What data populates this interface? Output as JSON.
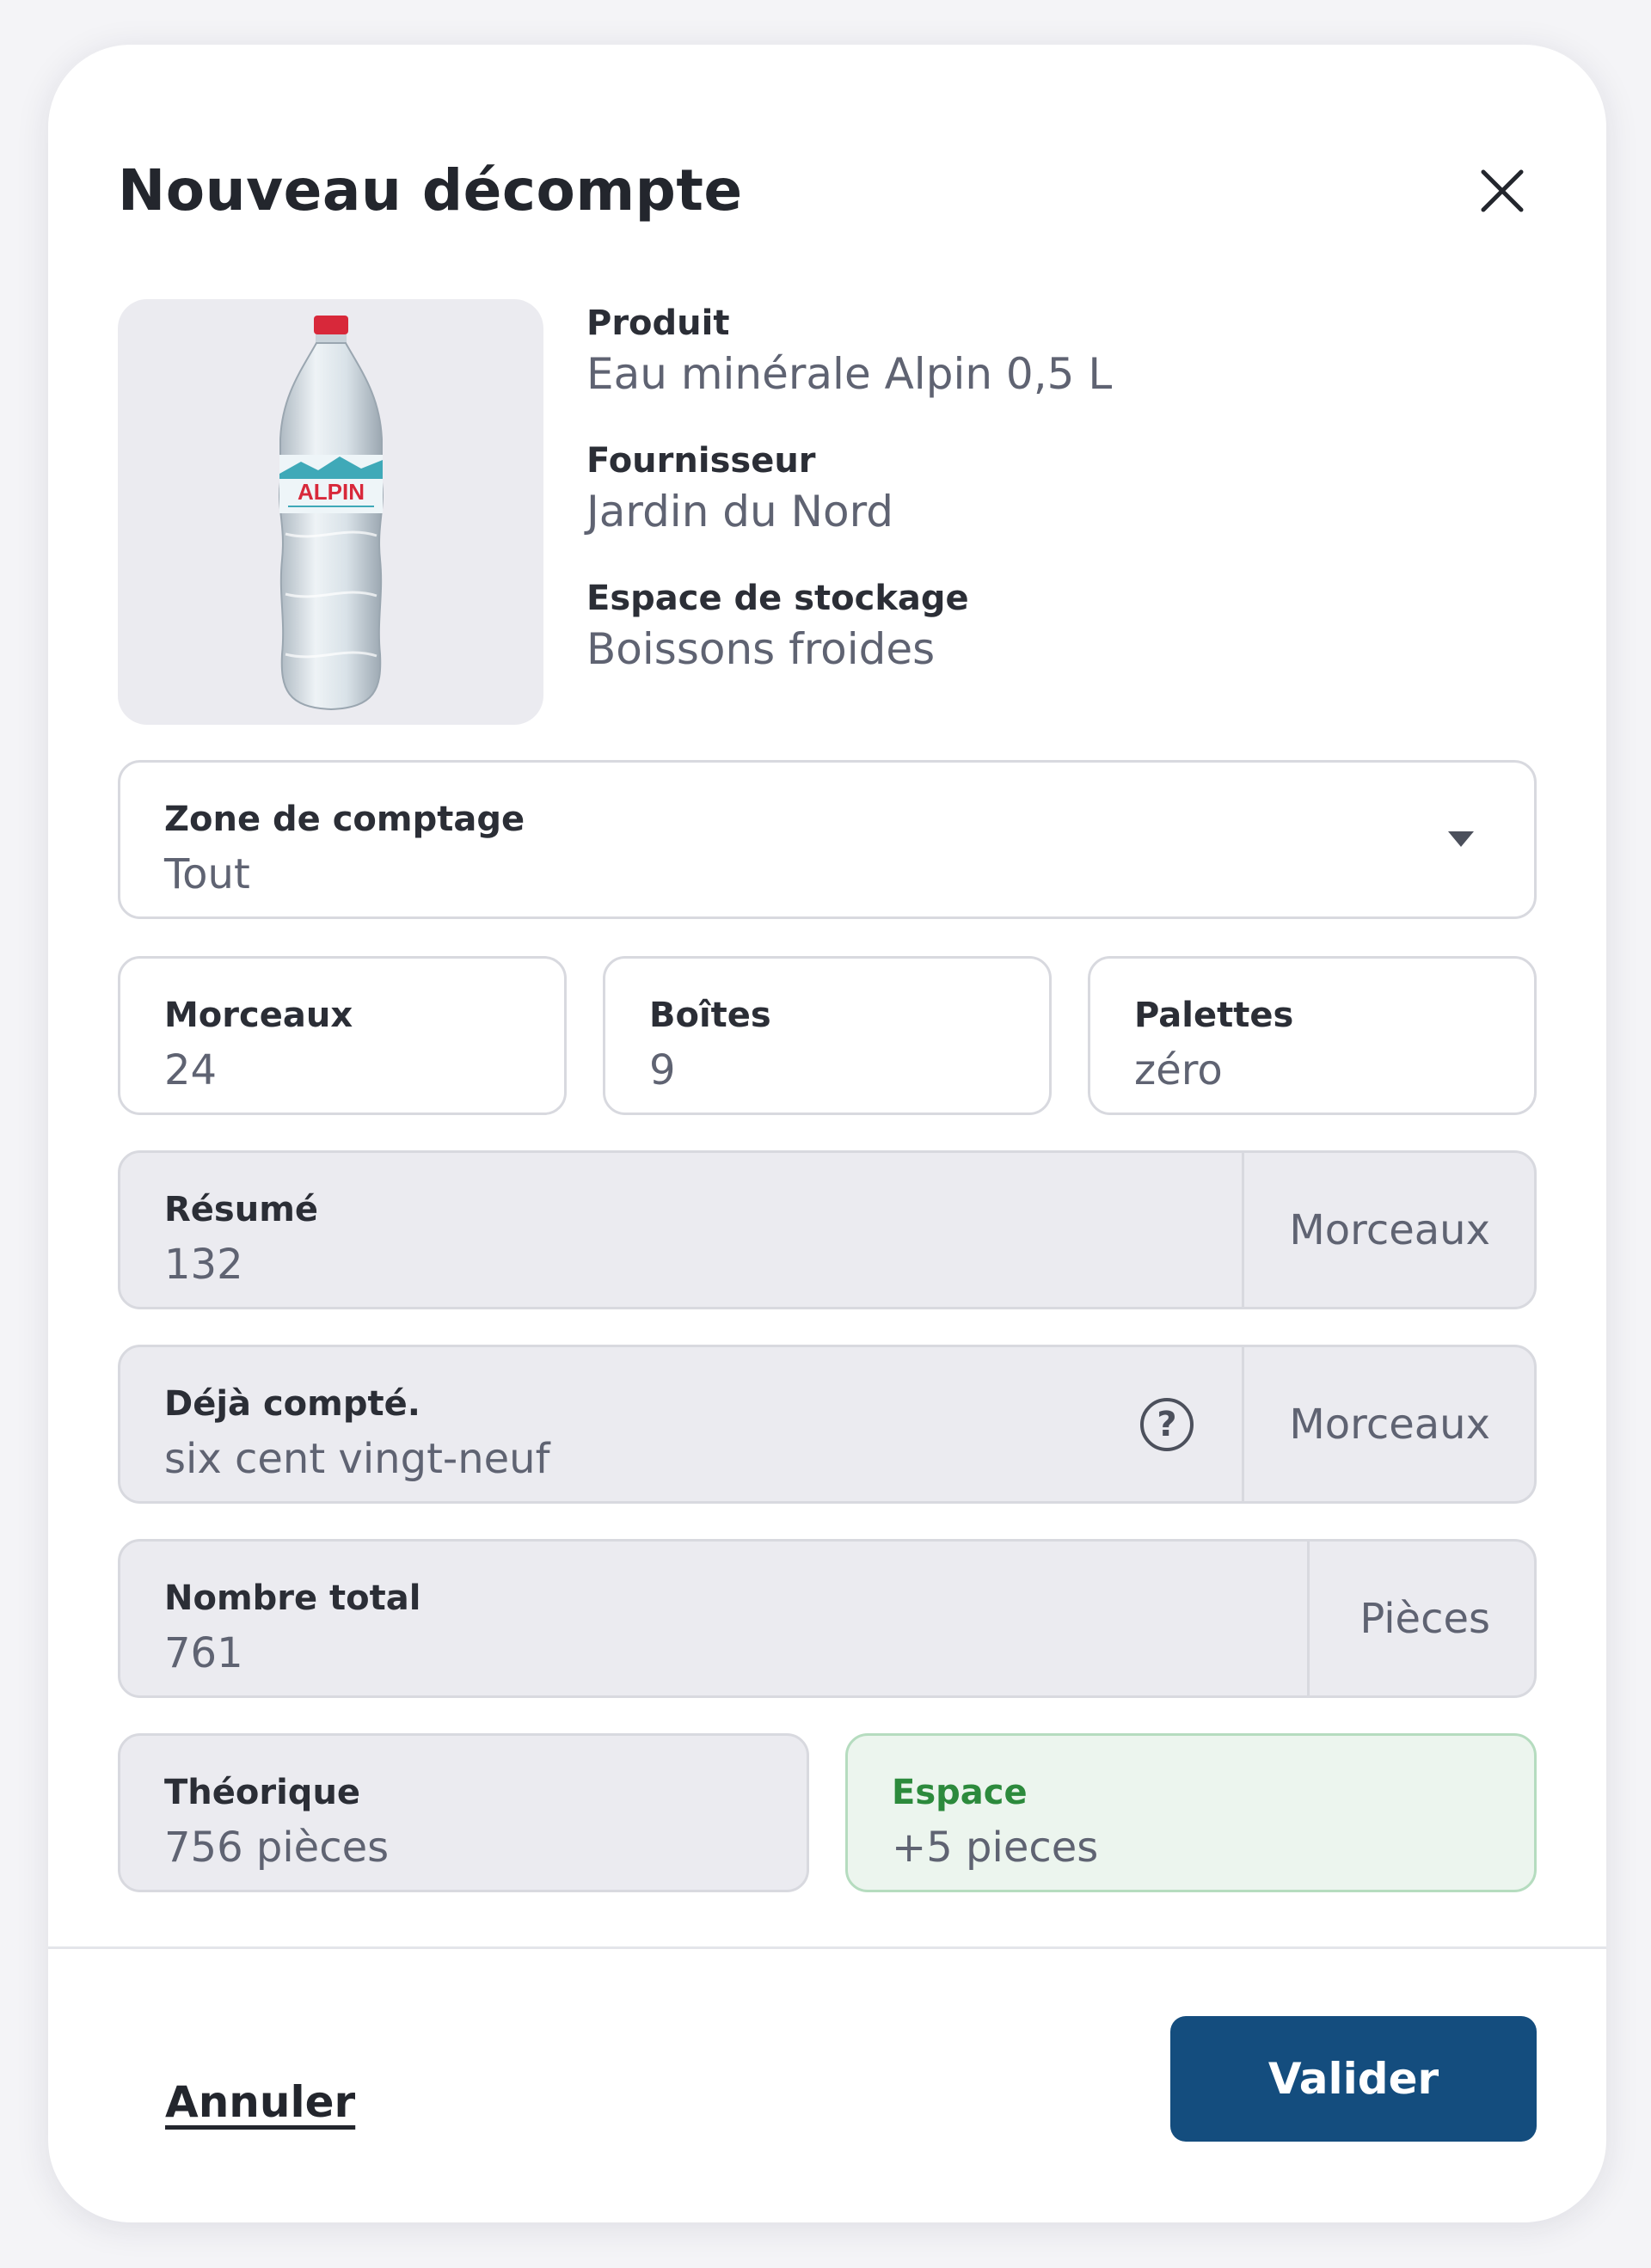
{
  "header": {
    "title": "Nouveau décompte",
    "close_icon": "close-icon"
  },
  "product": {
    "image_icon": "water-bottle-image",
    "brand_text": "ALPIN",
    "fields": [
      {
        "label": "Produit",
        "value": "Eau minérale Alpin 0,5 L"
      },
      {
        "label": "Fournisseur",
        "value": "Jardin du Nord"
      },
      {
        "label": "Espace de stockage",
        "value": "Boissons froides"
      }
    ]
  },
  "zone": {
    "label": "Zone de comptage",
    "value": "Tout",
    "icon": "chevron-down-icon"
  },
  "counts": {
    "pieces": {
      "label": "Morceaux",
      "value": "24"
    },
    "boxes": {
      "label": "Boîtes",
      "value": "9"
    },
    "pallets": {
      "label": "Palettes",
      "value": "zéro"
    }
  },
  "summary": {
    "label": "Résumé",
    "value": "132",
    "unit": "Morceaux"
  },
  "already": {
    "label": "Déjà compté.",
    "value": "six cent vingt-neuf",
    "unit": "Morceaux",
    "help_icon": "question-circle-icon",
    "help_glyph": "?"
  },
  "total": {
    "label": "Nombre total",
    "value": "761",
    "unit": "Pièces"
  },
  "theoretical": {
    "label": "Théorique",
    "value": "756 pièces"
  },
  "gap": {
    "label": "Espace",
    "value": "+5 pieces"
  },
  "footer": {
    "cancel_label": "Annuler",
    "submit_label": "Valider"
  },
  "colors": {
    "primary": "#144d7e",
    "success_text": "#2c8a3c",
    "success_bg": "#ecf5ee",
    "field_grey": "#ebebf0"
  }
}
